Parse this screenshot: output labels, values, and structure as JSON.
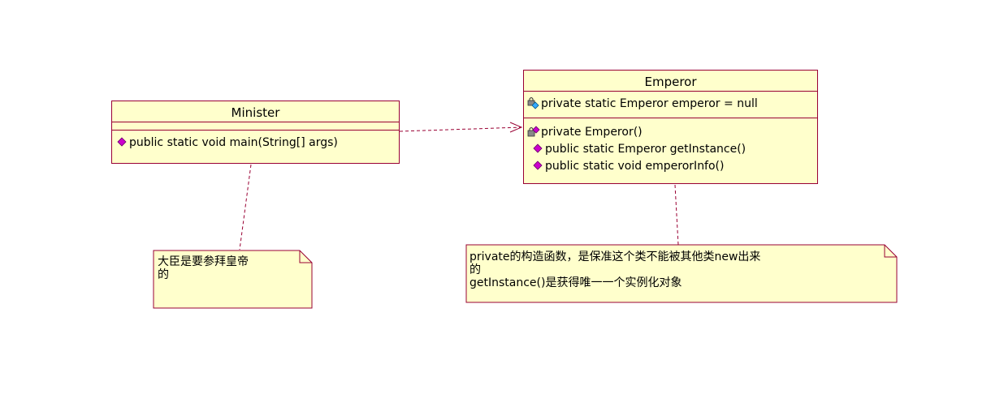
{
  "classes": {
    "minister": {
      "name": "Minister",
      "attributes": [],
      "operations": [
        {
          "text": "public static void main(String[] args)",
          "icon": "public-operation-icon"
        }
      ]
    },
    "emperor": {
      "name": "Emperor",
      "attributes": [
        {
          "text": "private static Emperor emperor = null",
          "icon": "private-static-attribute-icon"
        }
      ],
      "operations": [
        {
          "text": "private Emperor()",
          "icon": "private-operation-icon"
        },
        {
          "text": "public static Emperor getInstance()",
          "icon": "public-operation-icon"
        },
        {
          "text": "public static void emperorInfo()",
          "icon": "public-operation-icon"
        }
      ]
    }
  },
  "notes": {
    "minister_note": {
      "line1": "大臣是要参拜皇帝",
      "line2": "的"
    },
    "emperor_note": {
      "line1": "private的构造函数，是保准这个类不能被其他类new出来",
      "line2": "的",
      "line3": "getInstance()是获得唯一一个实例化对象"
    }
  },
  "colors": {
    "class_fill": "#ffffcc",
    "border": "#990033",
    "public_icon": "#cc00cc",
    "attribute_icon": "#33aaff",
    "lock_icon": "#444444"
  }
}
